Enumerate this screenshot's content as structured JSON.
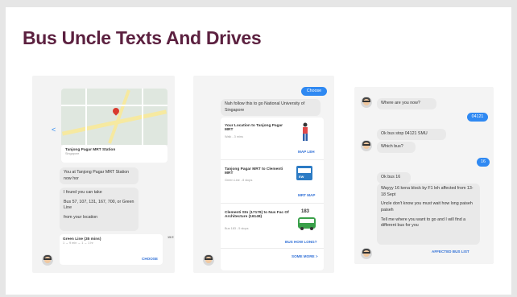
{
  "title": "Bus Uncle Texts And Drives",
  "panel1": {
    "map_station": "Tanjong Pagar MRT Station",
    "map_sub": "Singapore",
    "msg1": "You at Tanjong Pagar MRT Station now hor",
    "msg2": "I found you can take",
    "msg3": "Bus 57, 107, 131, 167, 700, or Green Line",
    "msg4": "from your location",
    "route_title": "Green Line (35 mins)",
    "route_sub": "1 → 9 min → 1 → 1 hr",
    "choose": "CHOOSE",
    "side_peek": "15 E"
  },
  "panel2": {
    "choose_btn": "Choose",
    "intro": "Nah follow this to go National University of Singapore",
    "step1_title": "Your Location to Tanjong Pagar MRT",
    "step1_sub": "Walk - 3 mins",
    "step1_link": "MAP LEH",
    "step2_title": "Tanjong Pagar MRT to Clementi MRT",
    "step2_sub": "Green Line - 8 stops",
    "step2_link": "MRT MAP",
    "train_label": "EW",
    "step3_title": "Clementi Stn (17179) to Nus Fac Of Architecture (16149)",
    "step3_sub": "Bus 183 - 5 stops",
    "step3_bus": "183",
    "step3_link": "BUS HOW LONG?",
    "more": "SOME MORE >"
  },
  "panel3": {
    "q1": "Where are you now?",
    "a1": "04121",
    "q2": "Ok bus stop 04121 SMU",
    "q3": "Which bus?",
    "a2": "16",
    "q4": "Ok bus 16",
    "q5a": "Wayyy 16 kena block by F1 leh affected from 13-18 Sept",
    "q5b": "Uncle don't know you must wait how long paiseh paiseh",
    "q5c": "Tell me where you want to go and I will find a different bus for you",
    "affected": "AFFECTED BUS LIST"
  }
}
